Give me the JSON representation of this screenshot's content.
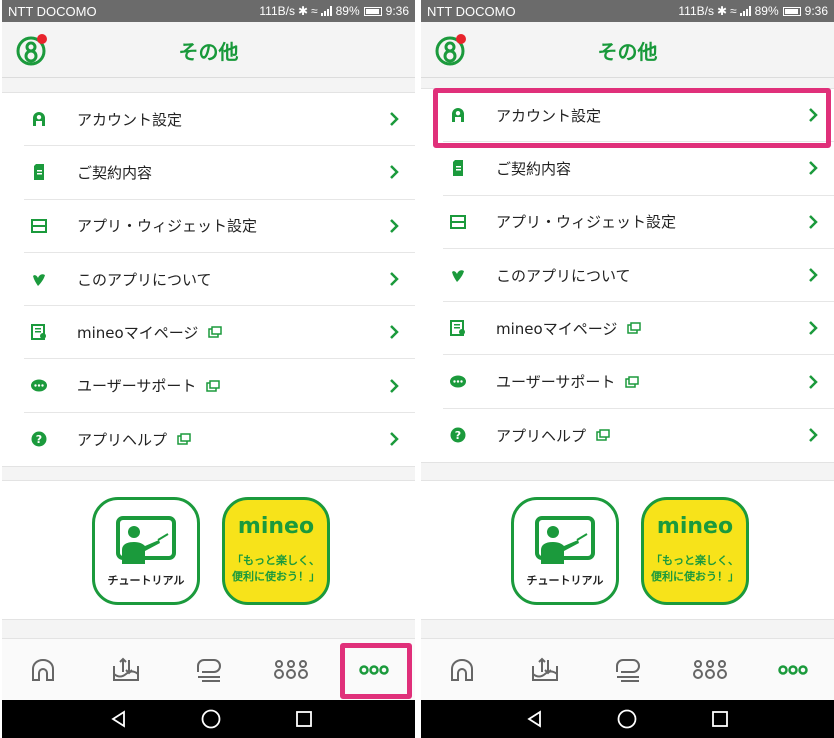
{
  "screens": {
    "left": {
      "status": {
        "carrier": "NTT DOCOMO",
        "speed": "111B/s",
        "battery": "89%",
        "time": "9:36"
      },
      "header": {
        "title": "その他"
      },
      "menu": [
        {
          "label": "アカウント設定"
        },
        {
          "label": "ご契約内容"
        },
        {
          "label": "アプリ・ウィジェット設定"
        },
        {
          "label": "このアプリについて"
        },
        {
          "label": "mineoマイページ"
        },
        {
          "label": "ユーザーサポート"
        },
        {
          "label": "アプリヘルプ"
        }
      ],
      "banners": {
        "tutorial_label": "チュートリアル",
        "mineo_brand": "mineo",
        "mineo_slogan_1": "「もっと楽しく、",
        "mineo_slogan_2": "便利に使おう！」"
      }
    },
    "right": {
      "status": {
        "carrier": "NTT DOCOMO",
        "speed": "111B/s",
        "battery": "89%",
        "time": "9:36"
      },
      "header": {
        "title": "その他"
      },
      "menu": [
        {
          "label": "アカウント設定"
        },
        {
          "label": "ご契約内容"
        },
        {
          "label": "アプリ・ウィジェット設定"
        },
        {
          "label": "このアプリについて"
        },
        {
          "label": "mineoマイページ"
        },
        {
          "label": "ユーザーサポート"
        },
        {
          "label": "アプリヘルプ"
        }
      ],
      "banners": {
        "tutorial_label": "チュートリアル",
        "mineo_brand": "mineo",
        "mineo_slogan_1": "「もっと楽しく、",
        "mineo_slogan_2": "便利に使おう！」"
      }
    }
  },
  "icons": [
    "avatar-icon",
    "account-icon",
    "contract-icon",
    "widget-icon",
    "heart-icon",
    "mypage-icon",
    "support-chat-icon",
    "help-icon",
    "chevron-right-icon",
    "external-link-icon",
    "home-icon",
    "data-transfer-icon",
    "coupon-icon",
    "community-icon",
    "more-icon",
    "back-icon",
    "home-nav-icon",
    "recents-icon"
  ],
  "colors": {
    "brand_green": "#1b9a3c",
    "highlight": "#e0307a",
    "mineo_yellow": "#f7e31a",
    "notification_red": "#e8242c"
  }
}
